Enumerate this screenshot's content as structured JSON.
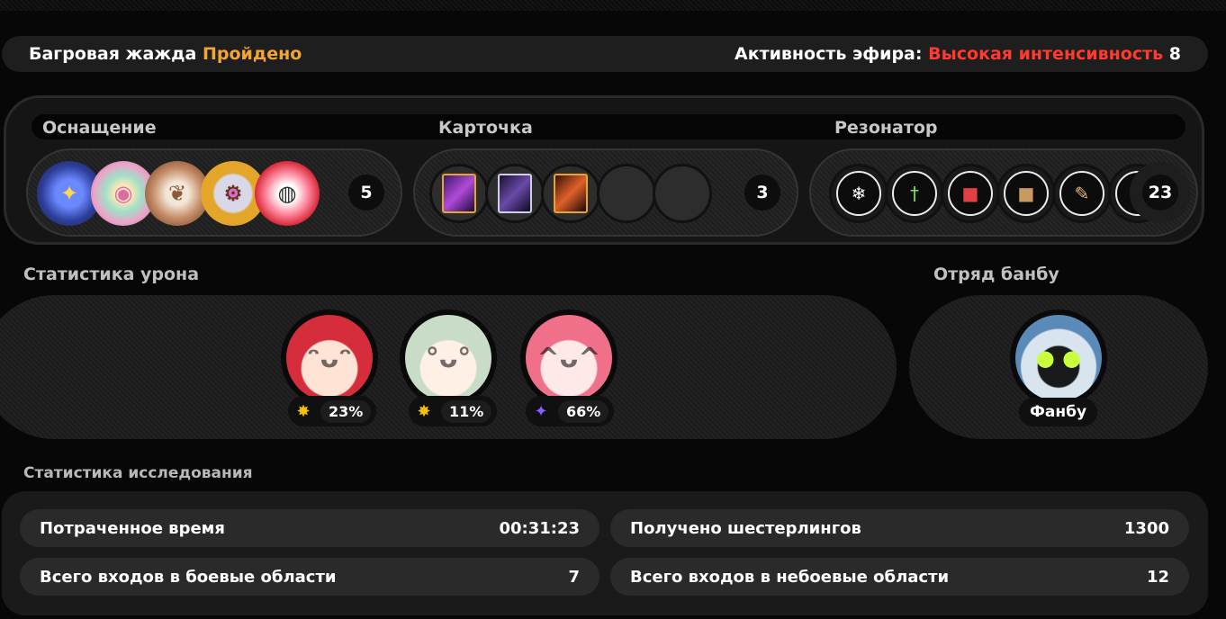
{
  "header": {
    "event_name": "Багровая жажда",
    "event_status": "Пройдено",
    "activity_label": "Активность эфира:",
    "activity_level": "Высокая интенсивность",
    "activity_value": "8"
  },
  "loadout": {
    "equipment": {
      "label": "Оснащение",
      "count": "5",
      "items": [
        "blue-crystal-emblem-icon",
        "pastel-ring-icon",
        "carved-sphere-icon",
        "gold-gear-emblem-icon",
        "pink-candy-icon"
      ]
    },
    "cards": {
      "label": "Карточка",
      "count": "3",
      "items": [
        "purple-card-icon",
        "violet-card-icon",
        "orange-card-icon"
      ],
      "empty_slots": 2
    },
    "resonator": {
      "label": "Резонатор",
      "count": "23",
      "items": [
        "crystal-emblem-icon",
        "green-sword-icon",
        "red-book-icon",
        "brown-book-icon",
        "scroll-icon",
        "red-emblem-icon"
      ]
    }
  },
  "damage_stats": {
    "title": "Статистика урона",
    "agents": [
      {
        "icon": "burst-icon",
        "percent": "23%",
        "percent_value": 23,
        "hair_color": "#d52d3b"
      },
      {
        "icon": "burst-icon",
        "percent": "11%",
        "percent_value": 11,
        "hair_color": "#c8dcc8"
      },
      {
        "icon": "sparkle-icon",
        "percent": "66%",
        "percent_value": 66,
        "hair_color": "#f0708a"
      }
    ]
  },
  "bangboo": {
    "title": "Отряд банбу",
    "name": "Фанбу"
  },
  "exploration": {
    "title": "Статистика исследования",
    "rows": [
      {
        "label": "Потраченное время",
        "value": "00:31:23"
      },
      {
        "label": "Получено шестерлингов",
        "value": "1300"
      },
      {
        "label": "Всего входов в боевые области",
        "value": "7"
      },
      {
        "label": "Всего входов в небоевые области",
        "value": "12"
      }
    ]
  }
}
